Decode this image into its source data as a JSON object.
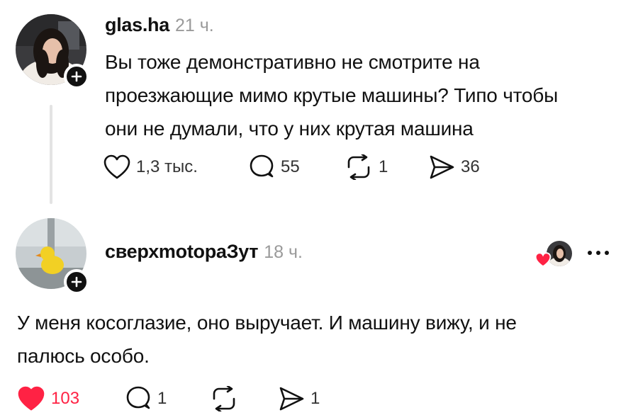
{
  "post": {
    "username": "glas.ha",
    "time": "21 ч.",
    "text_lines": [
      "Вы тоже демонстративно не смотрите на",
      "проезжающие мимо крутые машины? Типо чтобы",
      "они не думали, что у них крутая машина"
    ],
    "likes": "1,3 тыс.",
    "comments": "55",
    "reposts": "1",
    "shares": "36"
  },
  "reply": {
    "username": "сверхmotораЗут",
    "time": "18 ч.",
    "text_lines": [
      "У меня косоглазие, оно выручает. И машину вижу, и не",
      "палюсь особо."
    ],
    "likes": "103",
    "comments": "1",
    "shares": "1",
    "liked": true
  },
  "icons": {
    "heart": "heart-icon",
    "comment": "comment-icon",
    "repost": "repost-icon",
    "share": "share-icon",
    "plus": "plus-icon",
    "more": "more-icon"
  },
  "colors": {
    "like_red": "#ff2244",
    "text": "#111111",
    "muted": "#9a9a9a"
  }
}
